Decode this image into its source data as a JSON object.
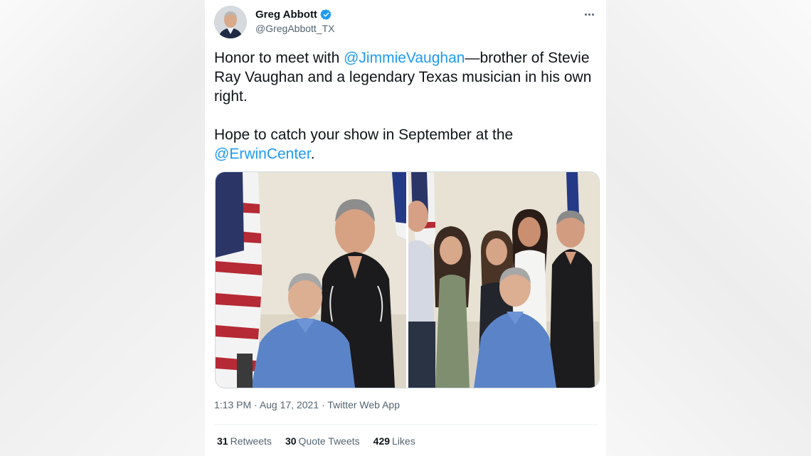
{
  "author": {
    "name": "Greg Abbott",
    "handle": "@GregAbbott_TX",
    "verified": true
  },
  "tweet": {
    "p1_start": "Honor to meet with ",
    "p1_mention": "@JimmieVaughan",
    "p1_end": "—brother of Stevie Ray Vaughan and a legendary Texas musician in his own right.",
    "p2_start": "Hope to catch your show in September at the ",
    "p2_mention": "@ErwinCenter",
    "p2_end": "."
  },
  "meta": {
    "time": "1:13 PM",
    "sep1": " · ",
    "date": "Aug 17, 2021",
    "sep2": " · ",
    "source": "Twitter Web App"
  },
  "stats": {
    "retweets_count": "31",
    "retweets_label": "Retweets",
    "quotes_count": "30",
    "quotes_label": "Quote Tweets",
    "likes_count": "429",
    "likes_label": "Likes"
  },
  "icons": {
    "verified": "verified-badge-icon",
    "more": "more-horizontal-icon"
  },
  "colors": {
    "link": "#1d9bf0",
    "text": "#0f1419",
    "muted": "#536471",
    "shirt": "#5b84c8"
  }
}
